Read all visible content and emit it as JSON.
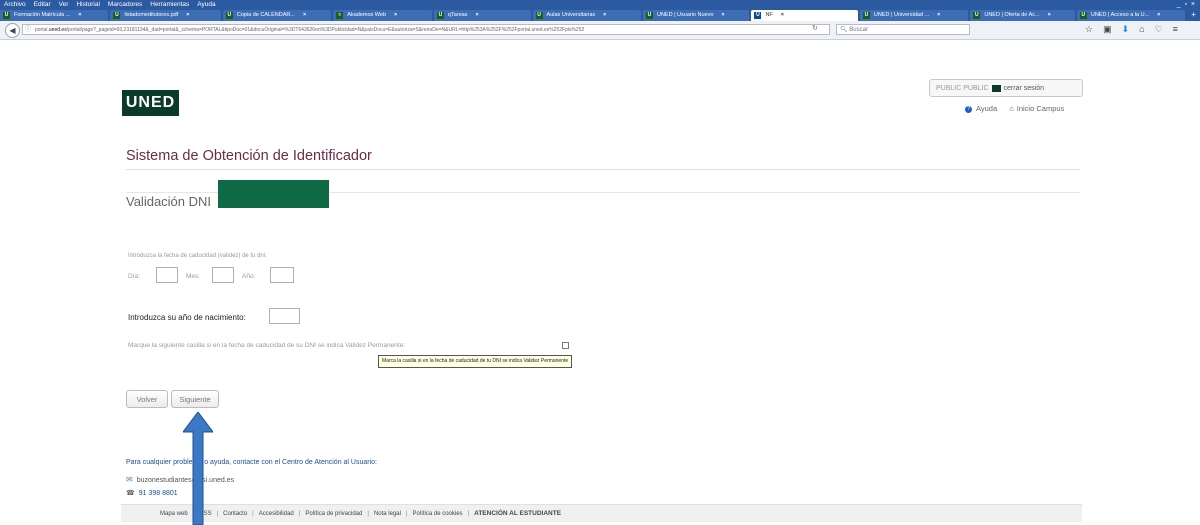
{
  "browser": {
    "menu": [
      "Archivo",
      "Editar",
      "Ver",
      "Historial",
      "Marcadores",
      "Herramientas",
      "Ayuda"
    ],
    "window_controls": "_ ▫ ×",
    "tabs": [
      {
        "label": "Formación Matrícula ...",
        "icon": "U",
        "active": false
      },
      {
        "label": "listadomeditutores.pdf",
        "icon": "U",
        "active": false
      },
      {
        "label": "Copia de CALENDAR...",
        "icon": "U",
        "active": false
      },
      {
        "label": "Akademos Web",
        "icon": "≈",
        "active": false
      },
      {
        "label": "qTareas",
        "icon": "U",
        "active": false
      },
      {
        "label": "Aulas Universitarias",
        "icon": "U",
        "active": false
      },
      {
        "label": "UNED | Usuario Nuevo",
        "icon": "U",
        "active": false
      },
      {
        "label": "NF",
        "icon": "U",
        "active": true
      },
      {
        "label": "UNED | Universidad ...",
        "icon": "U",
        "active": false
      },
      {
        "label": "UNED | Oferta de Ac...",
        "icon": "U",
        "active": false
      },
      {
        "label": "UNED | Acceso a la U...",
        "icon": "U",
        "active": false
      }
    ],
    "url_prefix": "portal.",
    "url_domain": "uned.es",
    "url_rest": "/portal/page?_pageid=93,23181134&_dad=portal&_schema=PORTAL&tipoDoc=01&docuOriginal=%3DT643626en%3DPublicidad=N&paisDocu=E&autoriza=S&reneDe=N&URL=http%253A%252F%252Fportal.uned.es%252Fpls%252",
    "search_placeholder": "Buscar"
  },
  "header": {
    "logo_text": "UNED",
    "user_text": "PUBLIC PUBLIC",
    "logout_label": "cerrar sesión",
    "help_label": "Ayuda",
    "home_label": "Inicio Campus"
  },
  "main": {
    "title": "Sistema de Obtención de Identificador",
    "subtitle": "Validación DNI",
    "expiry_prompt": "Introduzca la fecha de caducidad (validez) de tu dni:",
    "day_label": "Día:",
    "month_label": "Mes:",
    "year_label": "Año:",
    "birth_prompt": "Introduzca su año de nacimiento:",
    "permanent_prompt": "Marque la siguiente casilla si en la fecha de caducidad de su DNI se indica Validez Permanente:",
    "tooltip": "Marca la casilla si en la fecha de caducidad de tu DNI se indica Validez Permanente",
    "back_label": "Volver",
    "next_label": "Siguiente"
  },
  "contact": {
    "help_text": "Para cualquier problema o ayuda, contacte con el Centro de Atención al Usuario:",
    "email": "buzonestudiantes@csi.uned.es",
    "phone": "91 398 8801"
  },
  "footer": {
    "links": [
      "Mapa web",
      "RSS",
      "Contacto",
      "Accesibilidad",
      "Política de privacidad",
      "Nota legal",
      "Política de cookies"
    ],
    "highlight": "ATENCIÓN AL ESTUDIANTE"
  },
  "colors": {
    "browser_chrome": "#2c5aa0",
    "brand_green": "#0b3a2a",
    "title": "#6b2c45",
    "annotation_arrow": "#3b78c6"
  }
}
